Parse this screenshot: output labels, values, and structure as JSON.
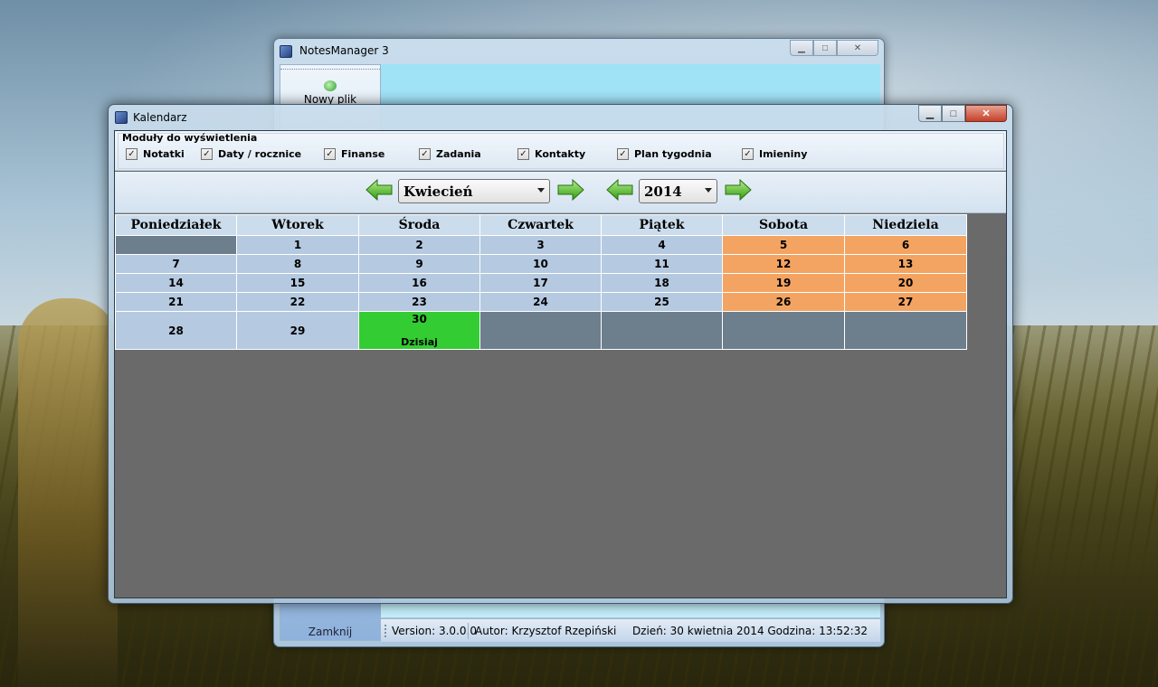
{
  "notesmanager": {
    "title": "NotesManager 3",
    "new_file_label": "Nowy plik",
    "close_label": "Zamknij",
    "status": {
      "version": "Version: 3.0.0.0",
      "author": "Autor: Krzysztof Rzepiński",
      "datetime": "Dzień: 30 kwietnia 2014 Godzina: 13:52:32"
    }
  },
  "calendar_window": {
    "title": "Kalendarz",
    "modules": {
      "title": "Moduły do wyświetlenia",
      "items": [
        {
          "label": "Notatki",
          "checked": true
        },
        {
          "label": "Daty / rocznice",
          "checked": true
        },
        {
          "label": "Finanse",
          "checked": true
        },
        {
          "label": "Zadania",
          "checked": true
        },
        {
          "label": "Kontakty",
          "checked": true
        },
        {
          "label": "Plan tygodnia",
          "checked": true
        },
        {
          "label": "Imieniny",
          "checked": true
        }
      ]
    },
    "nav": {
      "month": "Kwiecień",
      "year": "2014"
    },
    "days": [
      "Poniedziałek",
      "Wtorek",
      "Środa",
      "Czwartek",
      "Piątek",
      "Sobota",
      "Niedziela"
    ],
    "today_label": "Dzisiaj",
    "weeks": [
      [
        "",
        "1",
        "2",
        "3",
        "4",
        "5",
        "6"
      ],
      [
        "7",
        "8",
        "9",
        "10",
        "11",
        "12",
        "13"
      ],
      [
        "14",
        "15",
        "16",
        "17",
        "18",
        "19",
        "20"
      ],
      [
        "21",
        "22",
        "23",
        "24",
        "25",
        "26",
        "27"
      ],
      [
        "28",
        "29",
        "30",
        "",
        "",
        "",
        ""
      ]
    ],
    "colors": {
      "weekend": "#f4a462",
      "today": "#33cc33",
      "day": "#b5c9e0",
      "empty": "#6d7e8d",
      "header": "#cbdcec"
    }
  }
}
